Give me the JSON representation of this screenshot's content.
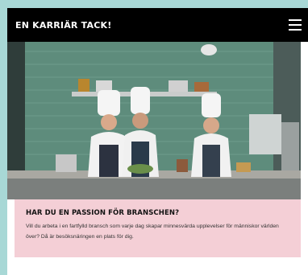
{
  "header": {
    "brand": "EN KARRIÄR TACK!"
  },
  "hero": {
    "alt": "Kockar i ett professionellt kök"
  },
  "card": {
    "title": "HAR DU EN PASSION FÖR BRANSCHEN?",
    "body": "Vill du arbeta i en fartfylld bransch som varje dag skapar minnesvärda upplevelser för människor världen över? Då är besöksnäringen en plats för dig."
  },
  "colors": {
    "header_bg": "#000000",
    "card_bg": "#f4cfd6",
    "page_bg": "#a8d8d6"
  }
}
